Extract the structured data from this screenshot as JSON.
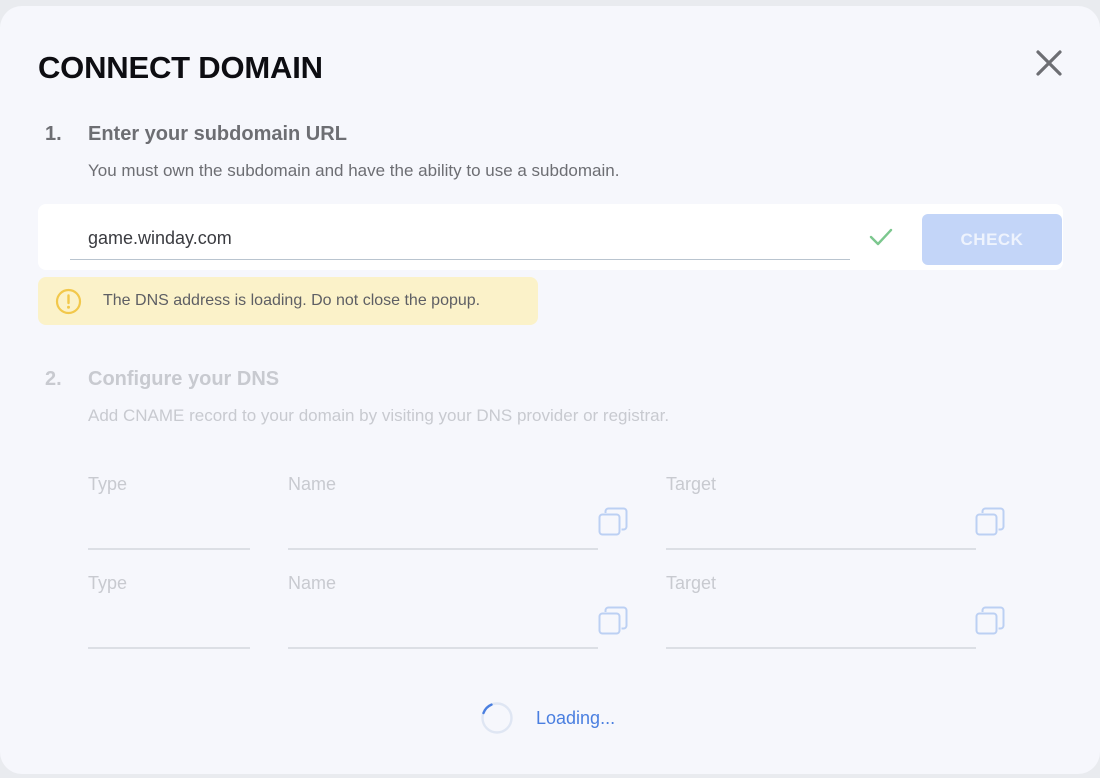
{
  "dialog": {
    "title": "CONNECT DOMAIN",
    "close_icon": "close-icon"
  },
  "step1": {
    "number": "1.",
    "title": "Enter your subdomain URL",
    "description": "You must own the subdomain and have the ability to use a subdomain.",
    "url_value": "game.winday.com",
    "valid_icon": "checkmark-icon",
    "check_label": "CHECK"
  },
  "alert": {
    "icon": "warning-icon",
    "text": "The DNS address is loading. Do not close the popup."
  },
  "step2": {
    "number": "2.",
    "title": "Configure your DNS",
    "description": "Add CNAME record to your domain by visiting your DNS provider or registrar.",
    "records": [
      {
        "type_label": "Type",
        "name_label": "Name",
        "target_label": "Target"
      },
      {
        "type_label": "Type",
        "name_label": "Name",
        "target_label": "Target"
      }
    ],
    "copy_icon": "copy-icon"
  },
  "status": {
    "loading_text": "Loading...",
    "spinner_icon": "spinner-icon"
  },
  "colors": {
    "accent": "#4a7fe0",
    "check_button_disabled": "#c3d5f8",
    "success": "#7cc78e",
    "warning": "#f2c84b",
    "alert_bg": "#fbf2c9"
  }
}
